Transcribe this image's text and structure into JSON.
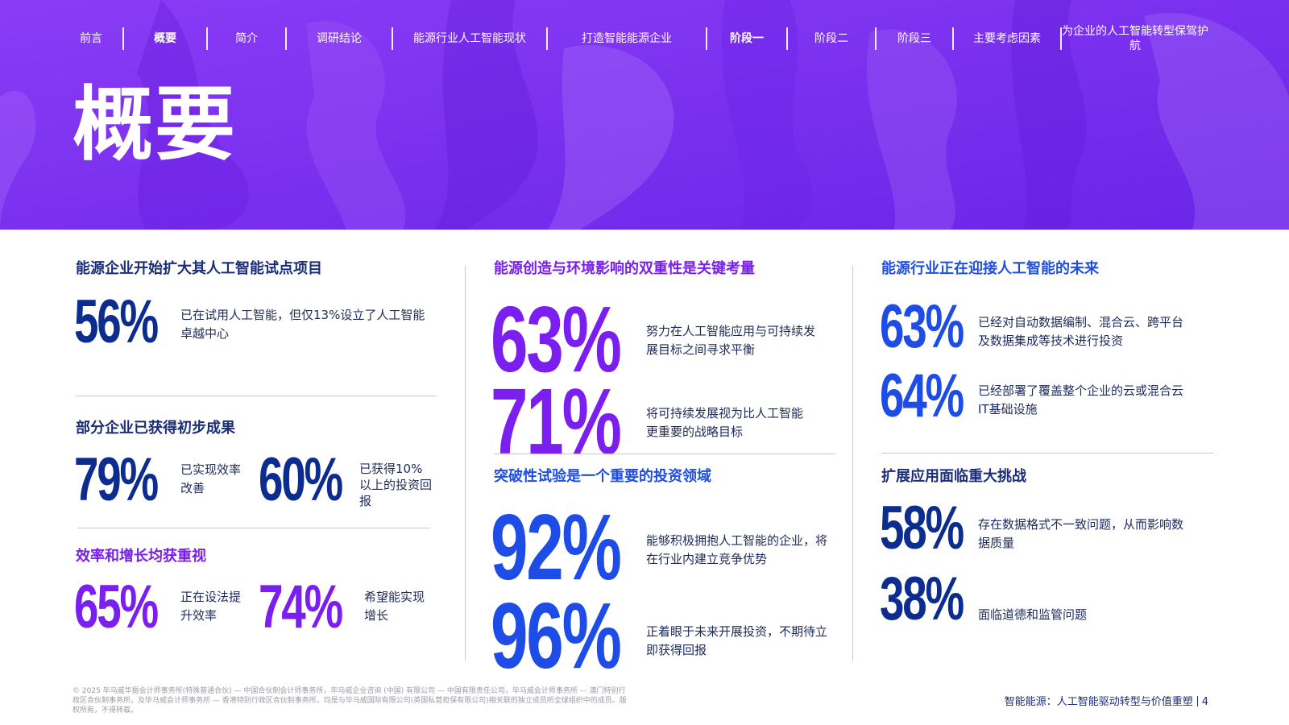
{
  "header": {
    "nav": [
      {
        "label": "前言",
        "active": false
      },
      {
        "label": "概要",
        "active": true
      },
      {
        "label": "简介",
        "active": false
      },
      {
        "label": "调研结论",
        "active": false
      },
      {
        "label": "能源行业人工智能现状",
        "active": false
      },
      {
        "label": "打造智能能源企业",
        "active": false
      },
      {
        "label": "阶段一",
        "active": true
      },
      {
        "label": "阶段二",
        "active": false
      },
      {
        "label": "阶段三",
        "active": false
      },
      {
        "label": "主要考虑因素",
        "active": false
      },
      {
        "label": "为企业的人工智能转型保驾护航",
        "active": false
      }
    ],
    "title": "概要"
  },
  "col1": {
    "s1": {
      "heading": "能源企业开始扩大其人工智能试点项目",
      "stat": "56%",
      "desc": "已在试用人工智能，但仅13%设立了人工智能卓越中心"
    },
    "s2": {
      "heading": "部分企业已获得初步成果",
      "stat_a": "79%",
      "desc_a": "已实现效率改善",
      "stat_b": "60%",
      "desc_b": "已获得10%以上的投资回报"
    },
    "s3": {
      "heading": "效率和增长均获重视",
      "stat_a": "65%",
      "desc_a": "正在设法提升效率",
      "stat_b": "74%",
      "desc_b": "希望能实现增长"
    }
  },
  "col2": {
    "s1": {
      "heading": "能源创造与环境影响的双重性是关键考量",
      "stat_a": "63%",
      "desc_a": "努力在人工智能应用与可持续发展目标之间寻求平衡",
      "stat_b": "71%",
      "desc_b": "将可持续发展视为比人工智能更重要的战略目标"
    },
    "s2": {
      "heading": "突破性试验是一个重要的投资领域",
      "stat_a": "92%",
      "desc_a": "能够积极拥抱人工智能的企业，将在行业内建立竞争优势",
      "stat_b": "96%",
      "desc_b": "正着眼于未来开展投资，不期待立即获得回报"
    }
  },
  "col3": {
    "s1": {
      "heading": "能源行业正在迎接人工智能的未来",
      "stat_a": "63%",
      "desc_a": "已经对自动数据编制、混合云、跨平台及数据集成等技术进行投资",
      "stat_b": "64%",
      "desc_b": "已经部署了覆盖整个企业的云或混合云IT基础设施"
    },
    "s2": {
      "heading": "扩展应用面临重大挑战",
      "stat_a": "58%",
      "desc_a": "存在数据格式不一致问题，从而影响数据质量",
      "stat_b": "38%",
      "desc_b": "面临道德和监管问题"
    }
  },
  "footer": {
    "legal": "© 2025 毕马威华振会计师事务所(特殊普通合伙) — 中国合伙制会计师事务所，毕马威企业咨询 (中国) 有限公司 — 中国有限责任公司，毕马威会计师事务所 — 澳门特别行政区合伙制事务所，及毕马威会计师事务所 — 香港特别行政区合伙制事务所，均是与毕马威国际有限公司(英国私营担保有限公司)相关联的独立成员所全球组织中的成员。版权所有，不得转载。",
    "doc_title": "智能能源：人工智能驱动转型与价值重塑",
    "page": "4"
  },
  "colors": {
    "hero": "#7b2ff0",
    "navy": "#0c2d8f",
    "purple": "#7b1ff0",
    "blue": "#1d4de6"
  }
}
